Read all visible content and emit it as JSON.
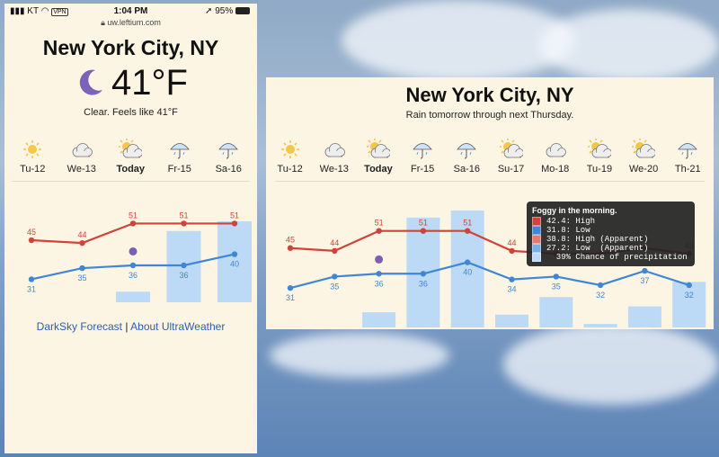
{
  "phone": {
    "status": {
      "carrier": "KT",
      "vpn": "VPN",
      "time": "1:04 PM",
      "battery": "95%",
      "url": "uw.leftium.com"
    },
    "city": "New York City, NY",
    "temperature": "41°F",
    "description": "Clear. Feels like 41°F",
    "days": [
      {
        "label": "Tu-12",
        "icon": "sun-icon"
      },
      {
        "label": "We-13",
        "icon": "cloud-icon"
      },
      {
        "label": "Today",
        "icon": "partly-cloudy-icon"
      },
      {
        "label": "Fr-15",
        "icon": "umbrella-icon"
      },
      {
        "label": "Sa-16",
        "icon": "umbrella-icon"
      }
    ],
    "footer_link_1": "DarkSky Forecast",
    "footer_sep": "|",
    "footer_link_2": "About UltraWeather"
  },
  "wide": {
    "city": "New York City, NY",
    "summary": "Rain tomorrow through next Thursday.",
    "days": [
      {
        "label": "Tu-12",
        "icon": "sun-icon"
      },
      {
        "label": "We-13",
        "icon": "cloud-icon"
      },
      {
        "label": "Today",
        "icon": "partly-cloudy-icon"
      },
      {
        "label": "Fr-15",
        "icon": "umbrella-icon"
      },
      {
        "label": "Sa-16",
        "icon": "umbrella-icon"
      },
      {
        "label": "Su-17",
        "icon": "partly-cloudy-icon"
      },
      {
        "label": "Mo-18",
        "icon": "cloud-icon"
      },
      {
        "label": "Tu-19",
        "icon": "partly-cloudy-icon"
      },
      {
        "label": "We-20",
        "icon": "partly-cloudy-icon"
      },
      {
        "label": "Th-21",
        "icon": "umbrella-icon"
      }
    ],
    "tooltip": {
      "title": "Foggy in the morning.",
      "rows": [
        {
          "text": "42.4: High",
          "color": "#d0433a"
        },
        {
          "text": "31.8: Low",
          "color": "#3f87d4"
        },
        {
          "text": "38.8: High (Apparent)",
          "color": "#e07a72"
        },
        {
          "text": "27.2: Low  (Apparent)",
          "color": "#79aee6"
        },
        {
          "text": "  39% Chance of precipitation",
          "color": "#bcd9f6"
        }
      ]
    }
  },
  "chart_data": [
    {
      "type": "line",
      "categories": [
        "Tu-12",
        "We-13",
        "Today",
        "Fr-15",
        "Sa-16"
      ],
      "series": [
        {
          "values": [
            45,
            44,
            51,
            51,
            51
          ],
          "color": "#d0433a"
        },
        {
          "values": [
            31,
            35,
            36,
            36,
            40
          ],
          "color": "#3f87d4"
        }
      ],
      "precipitation_chance": [
        0,
        0,
        0.13,
        0.88,
        1.0
      ],
      "current_temp": 41,
      "low_labels": [
        "31",
        "35",
        "36",
        "36",
        "40"
      ],
      "high_labels": [
        "45",
        "44",
        "51",
        "51",
        "51"
      ]
    },
    {
      "type": "line",
      "categories": [
        "Tu-12",
        "We-13",
        "Today",
        "Fr-15",
        "Sa-16",
        "Su-17",
        "Mo-18",
        "Tu-19",
        "We-20",
        "Th-21"
      ],
      "series": [
        {
          "values": [
            45,
            44,
            51,
            51,
            51,
            44,
            43,
            43,
            45,
            43
          ],
          "color": "#d0433a"
        },
        {
          "values": [
            31,
            35,
            36,
            36,
            40,
            34,
            35,
            32,
            37,
            32
          ],
          "color": "#3f87d4"
        }
      ],
      "precipitation_chance": [
        0,
        0,
        0.13,
        0.94,
        1.0,
        0.11,
        0.26,
        0.03,
        0.18,
        0.39
      ],
      "current_temp": 41,
      "high_labels": [
        "45",
        "44",
        "51",
        "51",
        "51",
        "44",
        "",
        "",
        "45",
        "43"
      ],
      "low_labels": [
        "31",
        "35",
        "36",
        "36",
        "40",
        "34",
        "35",
        "32",
        "37",
        "32"
      ]
    }
  ],
  "colors": {
    "high": "#d0433a",
    "low": "#3f87d4",
    "precip": "#bcd9f6",
    "current": "#7a5fb5",
    "link": "#2f5da8",
    "panel": "#fdf5e3"
  }
}
